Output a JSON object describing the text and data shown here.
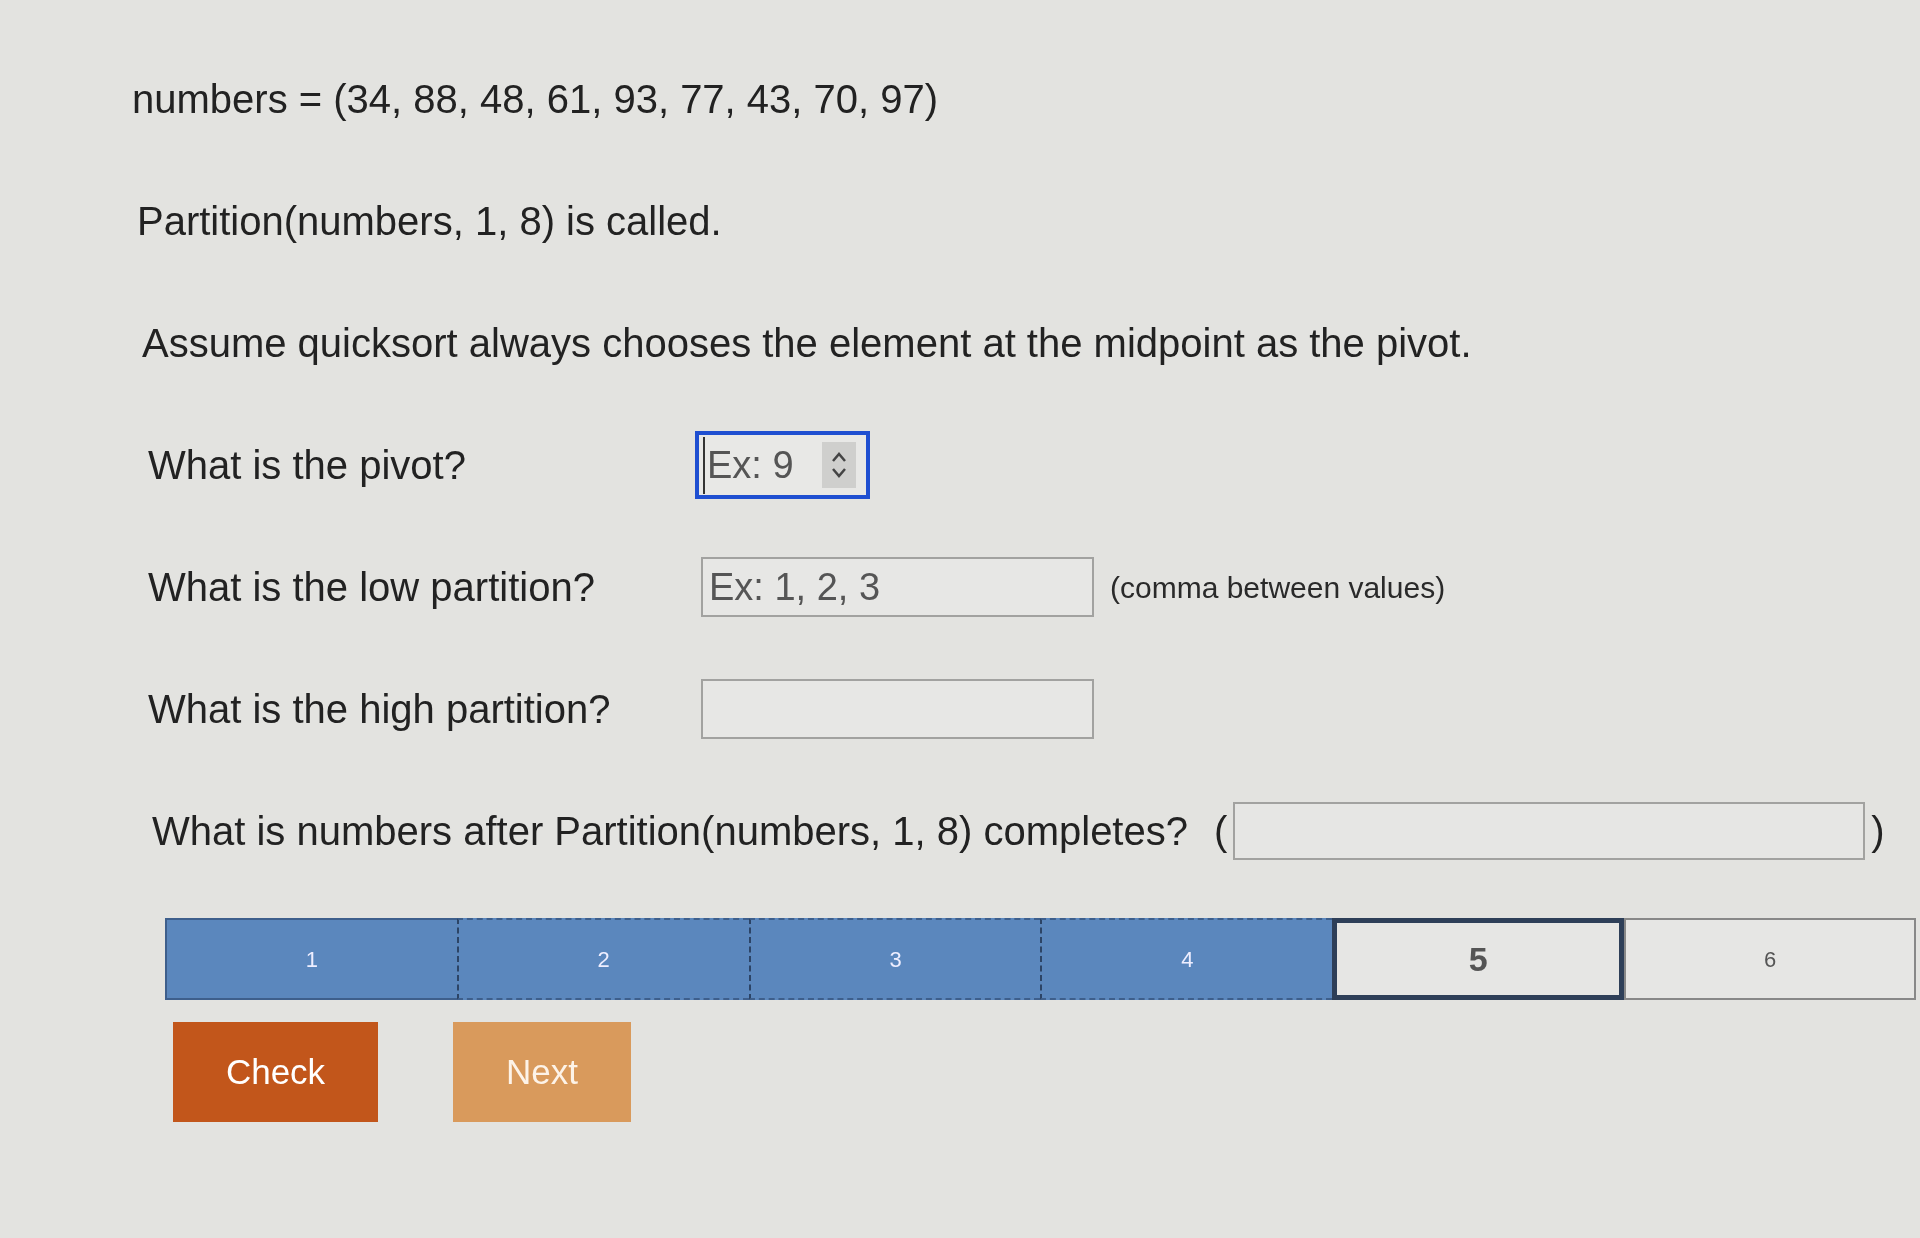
{
  "statements": [
    "numbers = (34, 88, 48, 61, 93, 77, 43, 70, 97)",
    "Partition(numbers, 1, 8) is called.",
    "Assume quicksort always chooses the element at the midpoint as the pivot."
  ],
  "questions": [
    {
      "kind": "number",
      "label": "What is the pivot?",
      "placeholder": "Ex: 9",
      "focused": true
    },
    {
      "kind": "text",
      "label": "What is the low partition?",
      "placeholder": "Ex: 1, 2, 3",
      "hint": "(comma between values)",
      "focused": false
    },
    {
      "kind": "text",
      "label": "What is the high partition?",
      "focused": false
    },
    {
      "kind": "wrapped",
      "label": "What is numbers after Partition(numbers, 1, 8) completes?",
      "prefix": "(",
      "suffix": ")",
      "focused": false
    }
  ],
  "progress": [
    {
      "label": "1",
      "completed": true,
      "selected": false
    },
    {
      "label": "2",
      "completed": true,
      "selected": false
    },
    {
      "label": "3",
      "completed": true,
      "selected": false
    },
    {
      "label": "4",
      "completed": true,
      "selected": false
    },
    {
      "label": "5",
      "completed": false,
      "selected": true
    },
    {
      "label": "6",
      "completed": false,
      "selected": false
    }
  ],
  "buttons": [
    {
      "label": "Check",
      "disabled": false
    },
    {
      "label": "Next",
      "disabled": true
    }
  ]
}
